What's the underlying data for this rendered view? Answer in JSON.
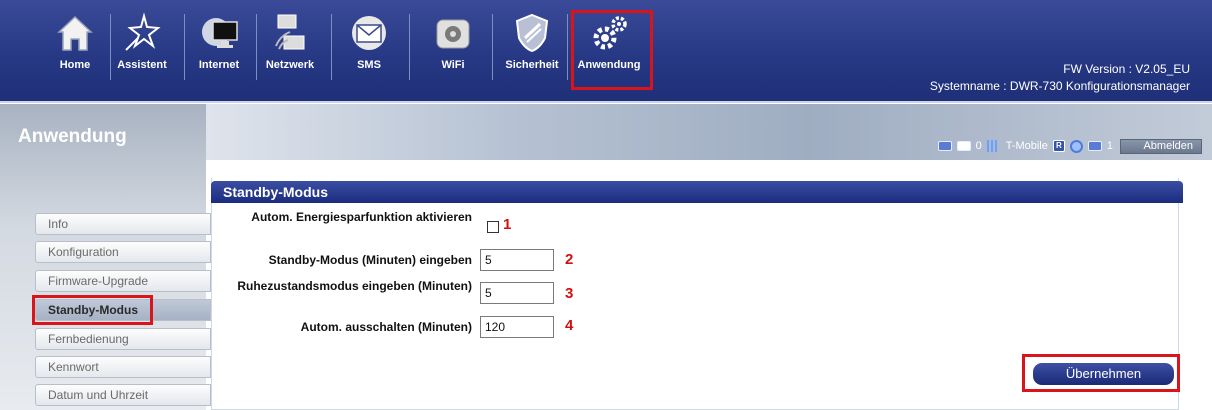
{
  "nav": {
    "items": [
      {
        "label": "Home",
        "icon": "home-icon"
      },
      {
        "label": "Assistent",
        "icon": "wizard-star-icon"
      },
      {
        "label": "Internet",
        "icon": "monitor-globe-icon"
      },
      {
        "label": "Netzwerk",
        "icon": "network-computers-icon"
      },
      {
        "label": "SMS",
        "icon": "envelope-icon"
      },
      {
        "label": "WiFi",
        "icon": "wifi-router-icon"
      },
      {
        "label": "Sicherheit",
        "icon": "shield-icon"
      },
      {
        "label": "Anwendung",
        "icon": "gears-icon"
      }
    ],
    "fw_version": "FW Version : V2.05_EU",
    "system_name": "Systemname : DWR-730 Konfigurationsmanager"
  },
  "section_title": "Anwendung",
  "status": {
    "sms_count": "0",
    "operator": "T-Mobile",
    "clients": "1",
    "logout_label": "Abmelden"
  },
  "sidebar": {
    "items": [
      "Info",
      "Konfiguration",
      "Firmware-Upgrade",
      "Standby-Modus",
      "Fernbedienung",
      "Kennwort",
      "Datum und Uhrzeit"
    ]
  },
  "form": {
    "header": "Standby-Modus",
    "energy_label": "Autom. Energiesparfunktion aktivieren",
    "standby_label": "Standby-Modus (Minuten) eingeben",
    "standby_value": "5",
    "sleep_label": "Ruhezustandsmodus eingeben (Minuten)",
    "sleep_value": "5",
    "poweroff_label": "Autom. ausschalten (Minuten)",
    "poweroff_value": "120",
    "apply_label": "Übernehmen"
  },
  "annotations": [
    "1",
    "2",
    "3",
    "4"
  ],
  "colors": {
    "nav_bg": "#273985",
    "highlight": "#d9141a",
    "marker": "#d01010"
  }
}
